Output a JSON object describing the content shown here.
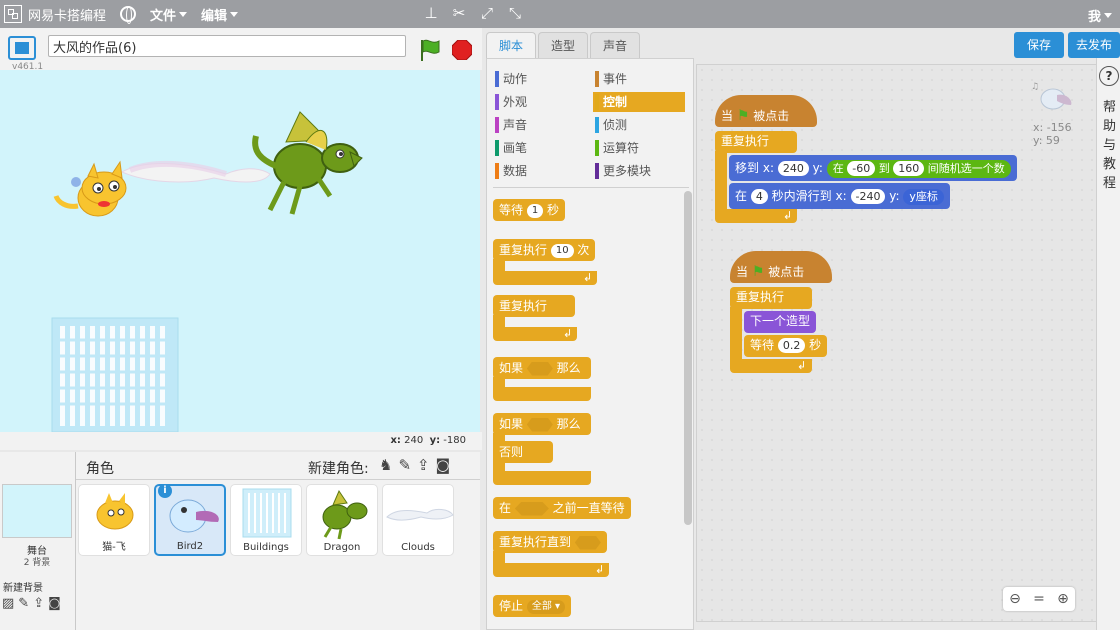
{
  "app": {
    "name": "网易卡搭编程",
    "menus": [
      "文件",
      "编辑"
    ],
    "user": "我"
  },
  "project": {
    "title": "大风的作品(6)",
    "version": "v461.1"
  },
  "stage": {
    "mouse_x_label": "x:",
    "mouse_x": "240",
    "mouse_y_label": "y:",
    "mouse_y": "-180"
  },
  "sprites": {
    "title": "角色",
    "new_sprite": "新建角色:",
    "stage_label": "舞台",
    "stage_sub": "2 背景",
    "new_backdrop": "新建背景",
    "items": [
      {
        "name": "猫-飞"
      },
      {
        "name": "Bird2",
        "selected": true
      },
      {
        "name": "Buildings"
      },
      {
        "name": "Dragon"
      },
      {
        "name": "Clouds"
      }
    ]
  },
  "tabs": [
    "脚本",
    "造型",
    "声音"
  ],
  "buttons": {
    "save": "保存",
    "share": "去发布"
  },
  "categories": [
    {
      "label": "动作",
      "color": "#4a6cd4"
    },
    {
      "label": "事件",
      "color": "#c88330"
    },
    {
      "label": "外观",
      "color": "#8a55d7"
    },
    {
      "label": "控制",
      "color": "#e1a91a",
      "selected": true
    },
    {
      "label": "声音",
      "color": "#bb42c3"
    },
    {
      "label": "侦测",
      "color": "#2ca5e2"
    },
    {
      "label": "画笔",
      "color": "#0e9a6c"
    },
    {
      "label": "运算符",
      "color": "#5cb712"
    },
    {
      "label": "数据",
      "color": "#ee7d16"
    },
    {
      "label": "更多模块",
      "color": "#632d99"
    }
  ],
  "palette": {
    "wait": "等待",
    "wait_val": "1",
    "sec": "秒",
    "repeat": "重复执行",
    "repeat_val": "10",
    "times": "次",
    "forever": "重复执行",
    "if": "如果",
    "then": "那么",
    "if2": "如果",
    "then2": "那么",
    "else": "否则",
    "wait_until_pre": "在",
    "wait_until_post": "之前一直等待",
    "repeat_until": "重复执行直到",
    "stop": "停止",
    "stop_val": "全部"
  },
  "scripts": {
    "sprite_x_label": "x:",
    "sprite_x": "-156",
    "sprite_y_label": "y:",
    "sprite_y": "59",
    "s1": {
      "hat": "当",
      "hat_post": "被点击",
      "forever": "重复执行",
      "goto": "移到",
      "x_label": "x:",
      "goto_x": "240",
      "y_label": "y:",
      "rand_pre": "在",
      "rand_from": "-60",
      "rand_mid": "到",
      "rand_to": "160",
      "rand_post": "间随机选一个数",
      "glide_pre": "在",
      "glide_secs": "4",
      "glide_mid": "秒内滑行到",
      "glide_x_label": "x:",
      "glide_x": "-240",
      "glide_y_label": "y:",
      "glide_y": "y座标"
    },
    "s2": {
      "hat": "当",
      "hat_post": "被点击",
      "forever": "重复执行",
      "next_costume": "下一个造型",
      "wait": "等待",
      "wait_val": "0.2",
      "sec": "秒"
    }
  },
  "help": {
    "q": "?",
    "text": "帮助与教程"
  }
}
